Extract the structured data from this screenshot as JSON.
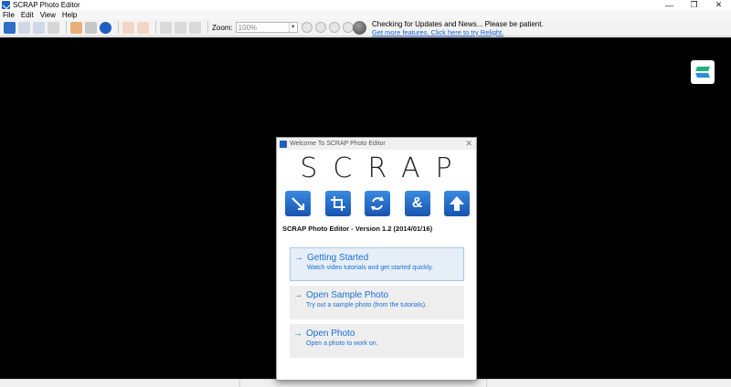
{
  "window": {
    "title": "SCRAP Photo Editor"
  },
  "window_controls": {
    "minimize": "—",
    "restore": "❐",
    "close": "✕"
  },
  "menu": [
    "File",
    "Edit",
    "View",
    "Help"
  ],
  "toolbar": {
    "zoom_label": "Zoom:",
    "zoom_value": "100%"
  },
  "update": {
    "message": "Checking for Updates and News... Please be patient.",
    "link": "Get more features. Click here to try Relight."
  },
  "dialog": {
    "title": "Welcome To SCRAP Photo Editor",
    "close": "✕",
    "logo_text": "SCRAP",
    "feature_icons": [
      "resize-icon",
      "crop-icon",
      "rotate-icon",
      "combine-icon",
      "upload-icon"
    ],
    "version": "SCRAP Photo Editor - Version 1.2 (2014/01/16)",
    "options": [
      {
        "title": "Getting Started",
        "desc": "Watch video tutorials and get started quickly.",
        "highlight": true
      },
      {
        "title": "Open Sample Photo",
        "desc": "Try out a sample photo (from the tutorials).",
        "highlight": false
      },
      {
        "title": "Open Photo",
        "desc": "Open a photo to work on.",
        "highlight": false
      }
    ]
  },
  "colors": {
    "accent": "#1c6fd1",
    "canvas": "#000000",
    "icon_blue": "#1f5fbf"
  }
}
